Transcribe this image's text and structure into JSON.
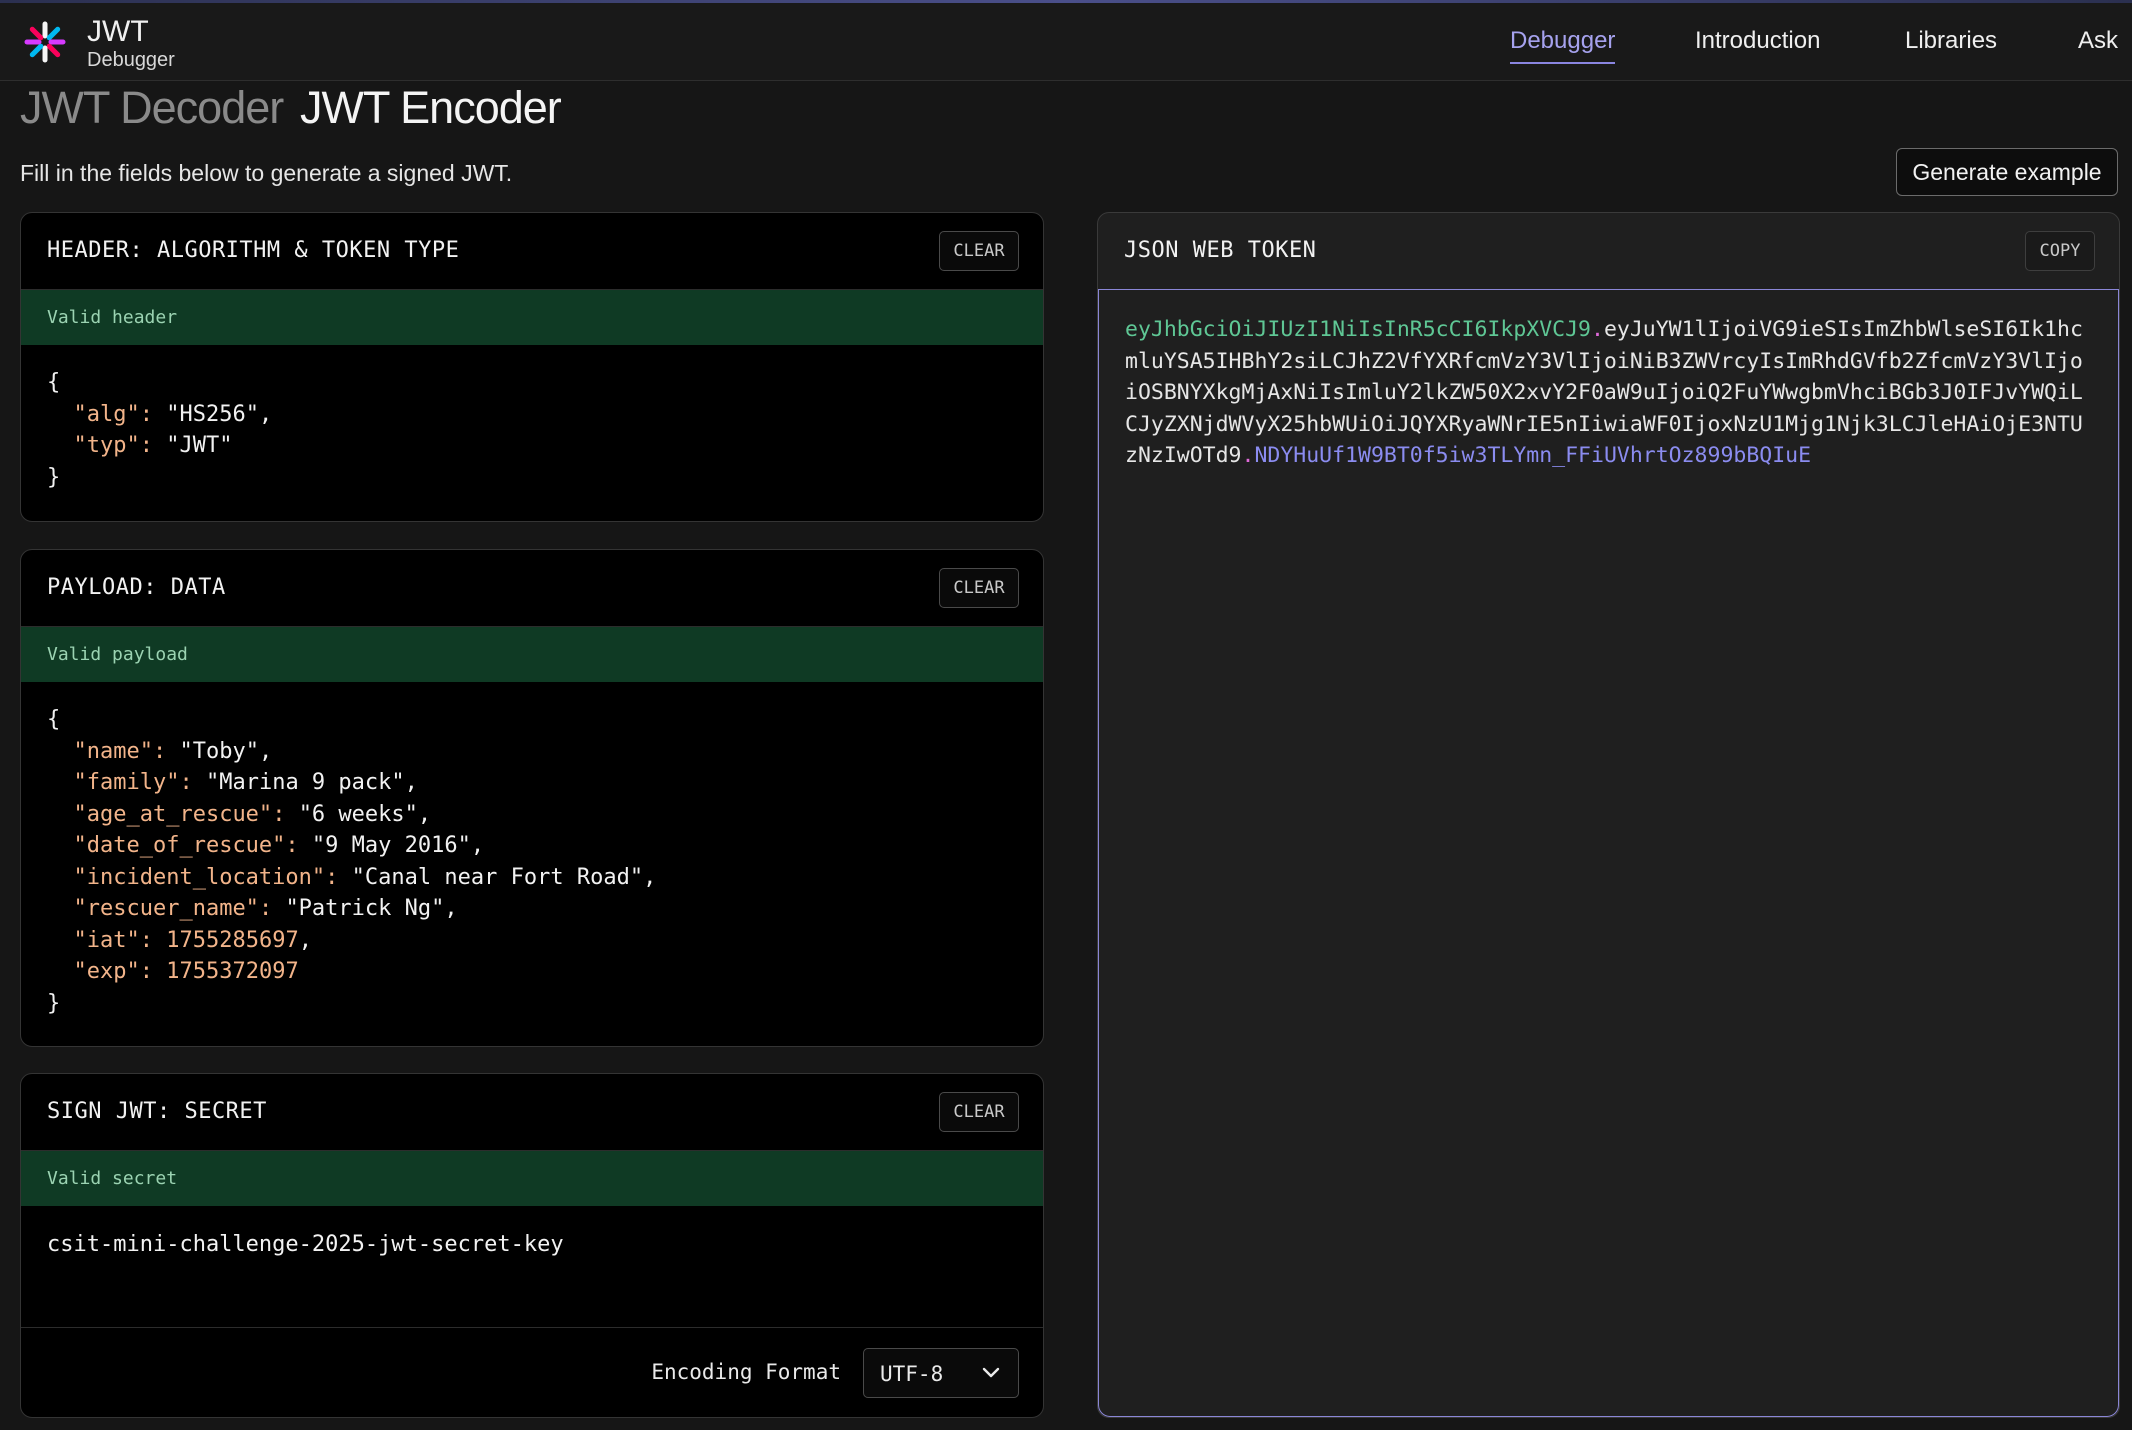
{
  "app": {
    "title": "JWT",
    "subtitle": "Debugger"
  },
  "nav": {
    "debugger": "Debugger",
    "introduction": "Introduction",
    "libraries": "Libraries",
    "ask": "Ask"
  },
  "tabs": {
    "decoder": "JWT Decoder",
    "encoder": "JWT Encoder"
  },
  "instructions": "Fill in the fields below to generate a signed JWT.",
  "generate_button": "Generate example",
  "header_panel": {
    "title": "HEADER: ALGORITHM & TOKEN TYPE",
    "clear": "CLEAR",
    "status": "Valid header",
    "lines": [
      {
        "key": "\"alg\"",
        "value": "\"HS256\"",
        "num": false,
        "comma": true
      },
      {
        "key": "\"typ\"",
        "value": "\"JWT\"",
        "num": false,
        "comma": false
      }
    ]
  },
  "payload_panel": {
    "title": "PAYLOAD: DATA",
    "clear": "CLEAR",
    "status": "Valid payload",
    "lines": [
      {
        "key": "\"name\"",
        "value": "\"Toby\"",
        "num": false,
        "comma": true
      },
      {
        "key": "\"family\"",
        "value": "\"Marina 9 pack\"",
        "num": false,
        "comma": true
      },
      {
        "key": "\"age_at_rescue\"",
        "value": "\"6 weeks\"",
        "num": false,
        "comma": true
      },
      {
        "key": "\"date_of_rescue\"",
        "value": "\"9 May 2016\"",
        "num": false,
        "comma": true
      },
      {
        "key": "\"incident_location\"",
        "value": "\"Canal near Fort Road\"",
        "num": false,
        "comma": true
      },
      {
        "key": "\"rescuer_name\"",
        "value": "\"Patrick Ng\"",
        "num": false,
        "comma": true
      },
      {
        "key": "\"iat\"",
        "value": "1755285697",
        "num": true,
        "comma": true
      },
      {
        "key": "\"exp\"",
        "value": "1755372097",
        "num": true,
        "comma": false
      }
    ]
  },
  "secret_panel": {
    "title": "SIGN JWT: SECRET",
    "clear": "CLEAR",
    "status": "Valid secret",
    "secret": "csit-mini-challenge-2025-jwt-secret-key",
    "encoding_label": "Encoding Format",
    "encoding_value": "UTF-8"
  },
  "jwt_panel": {
    "title": "JSON WEB TOKEN",
    "copy": "COPY",
    "token_header": "eyJhbGciOiJIUzI1NiIsInR5cCI6IkpXVCJ9",
    "token_payload": "eyJuYW1lIjoiVG9ieSIsImZhbWlseSI6Ik1hcmluYSA5IHBhY2siLCJhZ2VfYXRfcmVzY3VlIjoiNiB3ZWVrcyIsImRhdGVfb2ZfcmVzY3VlIjoiOSBNYXkgMjAxNiIsImluY2lkZW50X2xvY2F0aW9uIjoiQ2FuYWwgbmVhciBGb3J0IFJvYWQiLCJyZXNjdWVyX25hbWUiOiJQYXRyaWNrIE5nIiwiaWF0IjoxNzU1Mjg1Njk3LCJleHAiOjE3NTUzNzIwOTd9",
    "token_signature": "NDYHuUf1W9BT0f5iw3TLYmn_FFiUVhrtOz899bBQIuE",
    "separator": "."
  },
  "colors": {
    "accent": "#a6a2ee",
    "valid_bar": "#0f3a24",
    "token_header": "#5fc795",
    "token_signature": "#8b8cf0",
    "json_key": "#f2b48a"
  }
}
